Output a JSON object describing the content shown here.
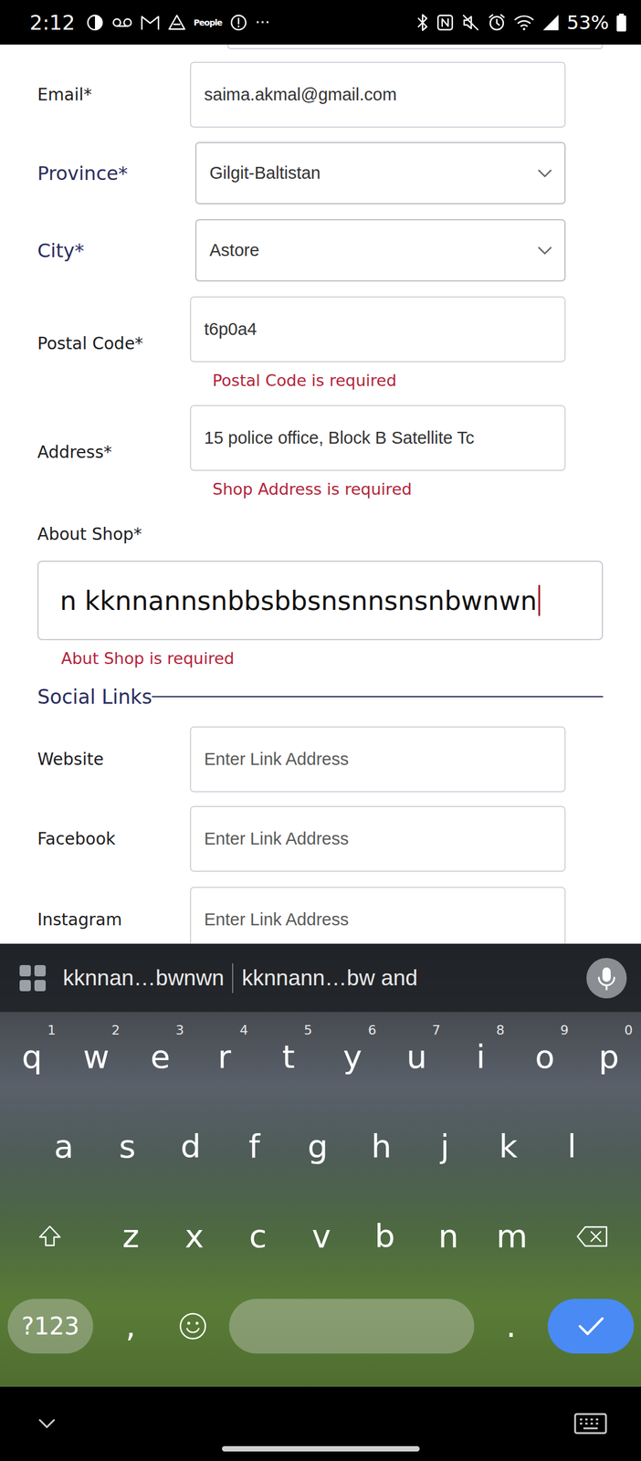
{
  "status_bar": {
    "time": "2:12",
    "notifications": [
      "People",
      "···"
    ],
    "battery": "53%"
  },
  "form": {
    "fields": [
      {
        "label": "Email*",
        "kind": "input",
        "value": "saima.akmal@gmail.com"
      },
      {
        "label": "Province*",
        "kind": "select",
        "value": "Gilgit-Baltistan"
      },
      {
        "label": "City*",
        "kind": "select",
        "value": "Astore"
      },
      {
        "label": "Postal Code*",
        "kind": "input",
        "value": "t6p0a4",
        "error": "Postal Code is required"
      },
      {
        "label": "Address*",
        "kind": "input",
        "value": "15 police office, Block B Satellite Tc",
        "error": "Shop Address is required"
      }
    ]
  },
  "about_shop": {
    "label": "About Shop*",
    "value": "n kknnannsnbbsbbsnsnnsnsnbwnwn",
    "error": "Abut Shop is required",
    "focused": true
  },
  "social_links": {
    "title": "Social Links",
    "fields": [
      {
        "label": "Website",
        "placeholder": "Enter Link Address"
      },
      {
        "label": "Facebook",
        "placeholder": "Enter Link Address"
      },
      {
        "label": "Instagram",
        "placeholder": "Enter Link Address"
      }
    ]
  },
  "keyboard": {
    "suggestions": [
      "kknnan…bwnwn",
      "kknnann…bw and"
    ],
    "rows": [
      [
        {
          "key": "q",
          "hint": "1"
        },
        {
          "key": "w",
          "hint": "2"
        },
        {
          "key": "e",
          "hint": "3"
        },
        {
          "key": "r",
          "hint": "4"
        },
        {
          "key": "t",
          "hint": "5"
        },
        {
          "key": "y",
          "hint": "6"
        },
        {
          "key": "u",
          "hint": "7"
        },
        {
          "key": "i",
          "hint": "8"
        },
        {
          "key": "o",
          "hint": "9"
        },
        {
          "key": "p",
          "hint": "0"
        }
      ],
      [
        {
          "key": "a"
        },
        {
          "key": "s"
        },
        {
          "key": "d"
        },
        {
          "key": "f"
        },
        {
          "key": "g"
        },
        {
          "key": "h"
        },
        {
          "key": "j"
        },
        {
          "key": "k"
        },
        {
          "key": "l"
        }
      ],
      [
        {
          "key": "z"
        },
        {
          "key": "x"
        },
        {
          "key": "c"
        },
        {
          "key": "v"
        },
        {
          "key": "b"
        },
        {
          "key": "n"
        },
        {
          "key": "m"
        }
      ]
    ],
    "symbols": "?123",
    "comma": ",",
    "period": "."
  }
}
